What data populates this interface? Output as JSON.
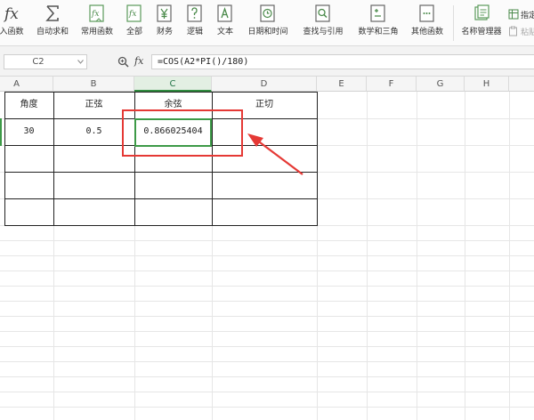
{
  "ribbon": {
    "buttons": [
      {
        "label": "插入函数",
        "visible_label": "入函数",
        "icon": "fx-icon"
      },
      {
        "label": "自动求和",
        "icon": "sigma-icon"
      },
      {
        "label": "常用函数",
        "icon": "function-icon"
      },
      {
        "label": "全部",
        "icon": "function-icon"
      },
      {
        "label": "财务",
        "icon": "yen-icon"
      },
      {
        "label": "逻辑",
        "icon": "logic-icon"
      },
      {
        "label": "文本",
        "icon": "text-icon"
      },
      {
        "label": "日期和时间",
        "icon": "clock-icon"
      },
      {
        "label": "查找与引用",
        "icon": "lookup-icon"
      },
      {
        "label": "数学和三角",
        "icon": "math-icon"
      },
      {
        "label": "其他函数",
        "icon": "more-icon"
      },
      {
        "label": "名称管理器",
        "icon": "name-manager-icon"
      }
    ],
    "small_buttons": [
      {
        "label": "指定",
        "visible_label": "指定"
      },
      {
        "label": "粘贴",
        "visible_label": "粘贴"
      }
    ],
    "accent": "#4a8a4a"
  },
  "formula_bar": {
    "name_box": "C2",
    "fx_label": "fx",
    "formula": "=COS(A2*PI()/180)"
  },
  "sheet": {
    "columns": [
      "A",
      "B",
      "C",
      "D",
      "E",
      "F",
      "G",
      "H"
    ],
    "active_column": "C",
    "table": {
      "headers": [
        "角度",
        "正弦",
        "余弦",
        "正切"
      ],
      "rows": [
        [
          "30",
          "0.5",
          "0.866025404",
          ""
        ],
        [
          "",
          "",
          "",
          ""
        ],
        [
          "",
          "",
          "",
          ""
        ],
        [
          "",
          "",
          "",
          ""
        ]
      ]
    },
    "active_cell": "C2",
    "highlight_color": "#e53935",
    "selection_color": "#3d9a47"
  }
}
